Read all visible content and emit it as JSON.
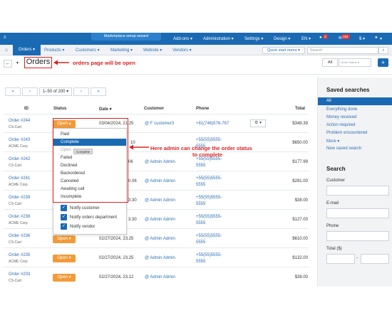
{
  "topbar": {
    "marketplace_button": "Marketplace setup wizard",
    "addons": "Add-ons ▾",
    "administration": "Administration ▾",
    "settings": "Settings ▾",
    "design": "Design ▾",
    "language": "EN ▾",
    "notifications_badge": "2",
    "messages_badge": "194",
    "currency": "$ ▾",
    "user_menu": "▾"
  },
  "nav": {
    "orders": "Orders ▾",
    "products": "Products ▾",
    "customers": "Customers ▾",
    "marketing": "Marketing ▾",
    "website": "Website ▾",
    "vendors": "Vendors ▾",
    "quick_start": "Quick start menu ▾",
    "search_placeholder": "Search"
  },
  "toolbar": {
    "title": "Orders",
    "annotation": "orders page will be open",
    "seg_all": "All",
    "seg_saved": "Order Status ▾"
  },
  "pager": {
    "first": "«",
    "prev": "‹",
    "range": "1–50 of 200 ▾",
    "next": "›",
    "last": "»"
  },
  "table": {
    "headers": {
      "id": "ID",
      "status": "Status",
      "date": "Date ▾",
      "customer": "Customer",
      "phone": "Phone",
      "total": "Total"
    },
    "rows": [
      {
        "id": "Order #244",
        "company": "CS-Cart",
        "status": "Open ▴",
        "date": "03/04/2024, 21:25",
        "customer": "@ F customer3",
        "phone": "+81(746)576-767",
        "phone2": "",
        "total": "$349.39"
      },
      {
        "id": "Order #243",
        "company": "ACME Corp",
        "status": "",
        "date": "10",
        "customer": "@ Admin Admin",
        "phone": "+55(55)5555-",
        "phone2": "5555",
        "total": "$650.00"
      },
      {
        "id": "Order #242",
        "company": "CS-Cart",
        "status": "",
        "date": "06",
        "customer": "@ Admin Admin",
        "phone": "+55(55)5555-",
        "phone2": "5555",
        "total": "$177.99"
      },
      {
        "id": "Order #241",
        "company": "ACME Corp",
        "status": "",
        "date": "0.06",
        "customer": "@ Admin Admin",
        "phone": "+55(55)5555-",
        "phone2": "5555",
        "total": "$281.00"
      },
      {
        "id": "Order #239",
        "company": "CS-Cart",
        "status": "",
        "date": "3.30",
        "customer": "@ Admin Admin",
        "phone": "+55(55)5555-",
        "phone2": "5555",
        "total": "$38.00"
      },
      {
        "id": "Order #238",
        "company": "ACME Corp",
        "status": "",
        "date": "3.30",
        "customer": "@ Admin Admin",
        "phone": "+55(55)5555-",
        "phone2": "5555",
        "total": "$127.00"
      },
      {
        "id": "Order #236",
        "company": "CS-Cart",
        "status": "Open ▾",
        "date": "02/27/2024, 23.25",
        "customer": "@ Admin Admin",
        "phone": "+55(55)5555-",
        "phone2": "5555",
        "total": "$610.00"
      },
      {
        "id": "Order #235",
        "company": "ACME Corp",
        "status": "Open ▾",
        "date": "02/27/2024, 23.25",
        "customer": "@ Admin Admin",
        "phone": "+55(55)5555-",
        "phone2": "5555",
        "total": "$132.00"
      },
      {
        "id": "Order #233",
        "company": "CS-Cart",
        "status": "Open ▾",
        "date": "02/27/2024, 23.12",
        "customer": "@ Admin Admin",
        "phone": "",
        "phone2": "",
        "total": "$38.00"
      }
    ]
  },
  "dropdown": {
    "items": [
      "Paid",
      "Complete",
      "Open",
      "Failed",
      "Declined",
      "Backordered",
      "Canceled",
      "Awaiting call",
      "Incomplete"
    ],
    "tooltip": "Complete",
    "checkboxes": [
      "Notify customer",
      "Notify orders department",
      "Notify vendor"
    ]
  },
  "annotation_status": {
    "line1": "Here admin can change the order status",
    "line2": "to complete"
  },
  "sidebar": {
    "saved_title": "Saved searches",
    "saved_items": [
      "All",
      "Everything done",
      "Money received",
      "Action required",
      "Problem encountered",
      "More ▾",
      "New saved search"
    ],
    "search_title": "Search",
    "customer_label": "Customer",
    "email_label": "E-mail",
    "phone_label": "Phone",
    "total_label": "Total ($)"
  },
  "colors": {
    "topbar": "#1a6ab3",
    "status_open": "#f29a38",
    "annotation": "#e02020"
  }
}
